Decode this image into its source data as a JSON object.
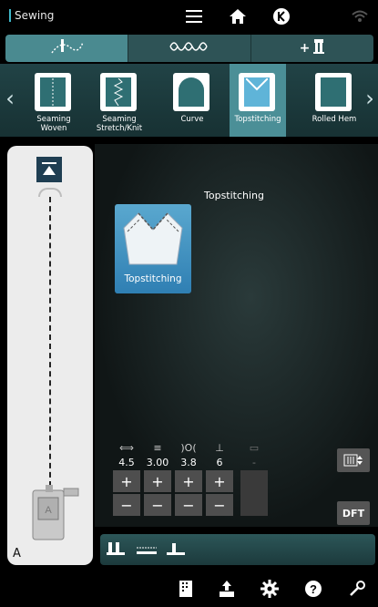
{
  "app": {
    "title": "Sewing"
  },
  "topbar": {
    "icons": [
      "menu-icon",
      "home-icon",
      "exit-icon",
      "wifi-icon"
    ]
  },
  "category_tabs": [
    {
      "name": "tab-sewing-techniques",
      "icon": "stitch-curve-icon",
      "active": true
    },
    {
      "name": "tab-decorative",
      "icon": "decorative-stitch-icon",
      "active": false
    },
    {
      "name": "tab-add-stitch",
      "icon": "plus-presser-foot-icon",
      "active": false,
      "label": "+"
    }
  ],
  "techniques": [
    {
      "label": "Seaming\nWoven",
      "active": false
    },
    {
      "label": "Seaming\nStretch/Knit",
      "active": false
    },
    {
      "label": "Curve",
      "active": false
    },
    {
      "label": "Topstitching",
      "active": true
    },
    {
      "label": "Rolled Hem",
      "active": false
    }
  ],
  "main": {
    "stitch_title": "Topstitching",
    "stitch_card_label": "Topstitching"
  },
  "presser_foot": {
    "label": "A"
  },
  "params": [
    {
      "icon": "stitch-width-icon",
      "value": "4.5",
      "plus": "+",
      "minus": "−",
      "enabled": true
    },
    {
      "icon": "stitch-length-icon",
      "value": "3.00",
      "plus": "+",
      "minus": "−",
      "enabled": true
    },
    {
      "icon": "thread-tension-icon",
      "value": "3.8",
      "plus": "+",
      "minus": "−",
      "enabled": true
    },
    {
      "icon": "presser-foot-pressure-icon",
      "value": "6",
      "plus": "+",
      "minus": "−",
      "enabled": true
    },
    {
      "icon": "density-icon",
      "value": "-",
      "plus": "",
      "minus": "",
      "enabled": false
    }
  ],
  "side_buttons": {
    "mirror_label": "",
    "dft_label": "DFT"
  },
  "colors": {
    "accent": "#3fb7c9",
    "active_tab": "#4a8a90",
    "active_technique": "#4b8f97"
  }
}
